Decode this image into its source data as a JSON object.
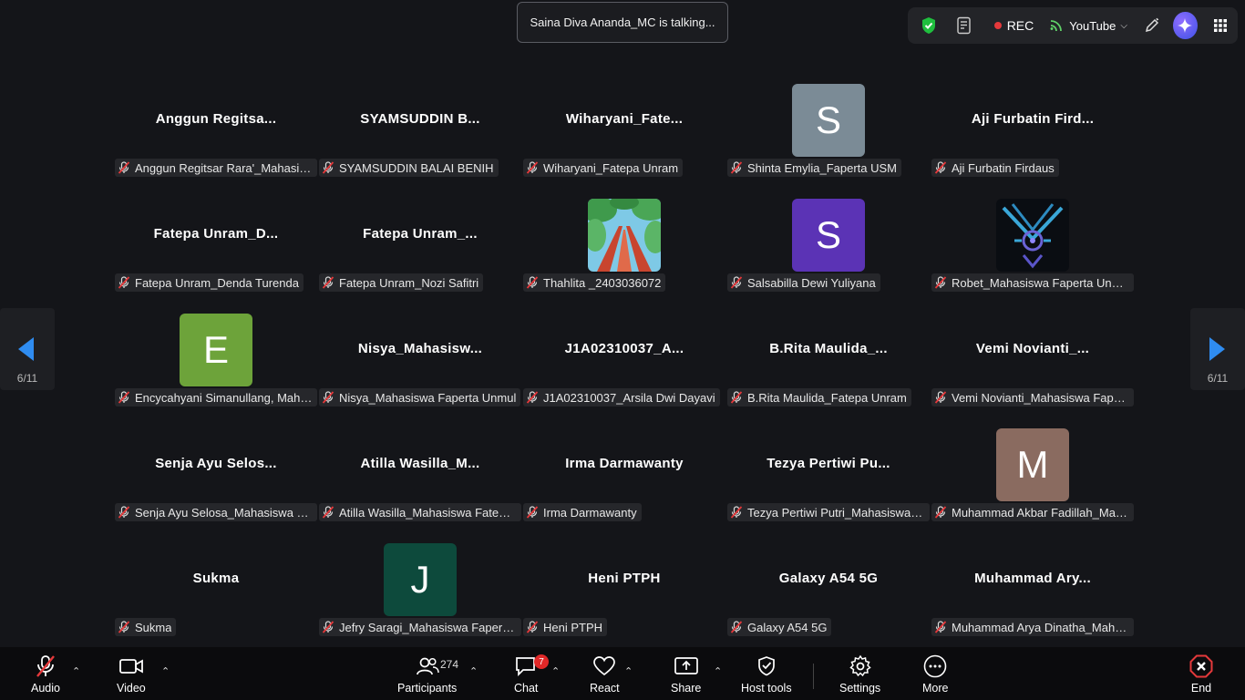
{
  "banner": {
    "talking": "Saina Diva Ananda_MC is talking..."
  },
  "topbar": {
    "rec": "REC",
    "stream": "YouTube",
    "shield_color": "#1fbf3e"
  },
  "pagination": {
    "current": "6/11"
  },
  "tiles": [
    {
      "title": "Anggun  Regitsa...",
      "label": "Anggun Regitsar Rara'_Mahasis...",
      "avatar": ""
    },
    {
      "title": "SYAMSUDDIN  B...",
      "label": "SYAMSUDDIN BALAI BENIH",
      "avatar": ""
    },
    {
      "title": "Wiharyani_Fate...",
      "label": "Wiharyani_Fatepa Unram",
      "avatar": ""
    },
    {
      "title": "",
      "label": "Shinta Emylia_Faperta USM",
      "avatar": "S",
      "avatar_color": "#7b8b96"
    },
    {
      "title": "Aji  Furbatin  Fird...",
      "label": "Aji Furbatin Firdaus",
      "avatar": ""
    },
    {
      "title": "Fatepa  Unram_D...",
      "label": "Fatepa Unram_Denda Turenda",
      "avatar": ""
    },
    {
      "title": "Fatepa  Unram_...",
      "label": "Fatepa Unram_Nozi Safitri",
      "avatar": ""
    },
    {
      "title": "",
      "label": "Thahlita _2403036072",
      "avatar": "",
      "avatar_image": "forest"
    },
    {
      "title": "",
      "label": "Salsabilla Dewi Yuliyana",
      "avatar": "S",
      "avatar_color": "#5b33b5"
    },
    {
      "title": "",
      "label": "Robet_Mahasiswa Faperta Unmul",
      "avatar": "",
      "avatar_image": "emblem"
    },
    {
      "title": "",
      "label": "Encycahyani Simanullang, Mahas...",
      "avatar": "E",
      "avatar_color": "#6da33a"
    },
    {
      "title": "Nisya_Mahasisw...",
      "label": "Nisya_Mahasiswa Faperta Unmul",
      "avatar": ""
    },
    {
      "title": "J1A02310037_A...",
      "label": "J1A02310037_Arsila Dwi Dayavi",
      "avatar": ""
    },
    {
      "title": "B.Rita  Maulida_...",
      "label": "B.Rita Maulida_Fatepa Unram",
      "avatar": ""
    },
    {
      "title": "Vemi  Novianti_...",
      "label": "Vemi Novianti_Mahasiswa Fapert...",
      "avatar": ""
    },
    {
      "title": "Senja  Ayu  Selos...",
      "label": "Senja Ayu Selosa_Mahasiswa Fat...",
      "avatar": ""
    },
    {
      "title": "Atilla  Wasilla_M...",
      "label": "Atilla Wasilla_Mahasiswa Fatepa ...",
      "avatar": ""
    },
    {
      "title": "Irma Darmawanty",
      "label": "Irma Darmawanty",
      "avatar": ""
    },
    {
      "title": "Tezya  Pertiwi  Pu...",
      "label": "Tezya Pertiwi Putri_Mahasiswa Fa...",
      "avatar": ""
    },
    {
      "title": "",
      "label": "Muhammad Akbar Fadillah_Mah...",
      "avatar": "M",
      "avatar_color": "#8a6b60"
    },
    {
      "title": "Sukma",
      "label": "Sukma",
      "avatar": ""
    },
    {
      "title": "",
      "label": "Jefry Saragi_Mahasiswa Faperta ...",
      "avatar": "J",
      "avatar_color": "#0d4a3c"
    },
    {
      "title": "Heni PTPH",
      "label": "Heni PTPH",
      "avatar": ""
    },
    {
      "title": "Galaxy A54 5G",
      "label": "Galaxy A54 5G",
      "avatar": ""
    },
    {
      "title": "Muhammad  Ary...",
      "label": "Muhammad Arya Dinatha_Maha...",
      "avatar": ""
    }
  ],
  "toolbar": {
    "audio": "Audio",
    "video": "Video",
    "participants": "Participants",
    "participants_count": "274",
    "chat": "Chat",
    "chat_badge": "7",
    "react": "React",
    "share": "Share",
    "host_tools": "Host tools",
    "settings": "Settings",
    "more": "More",
    "end": "End"
  }
}
